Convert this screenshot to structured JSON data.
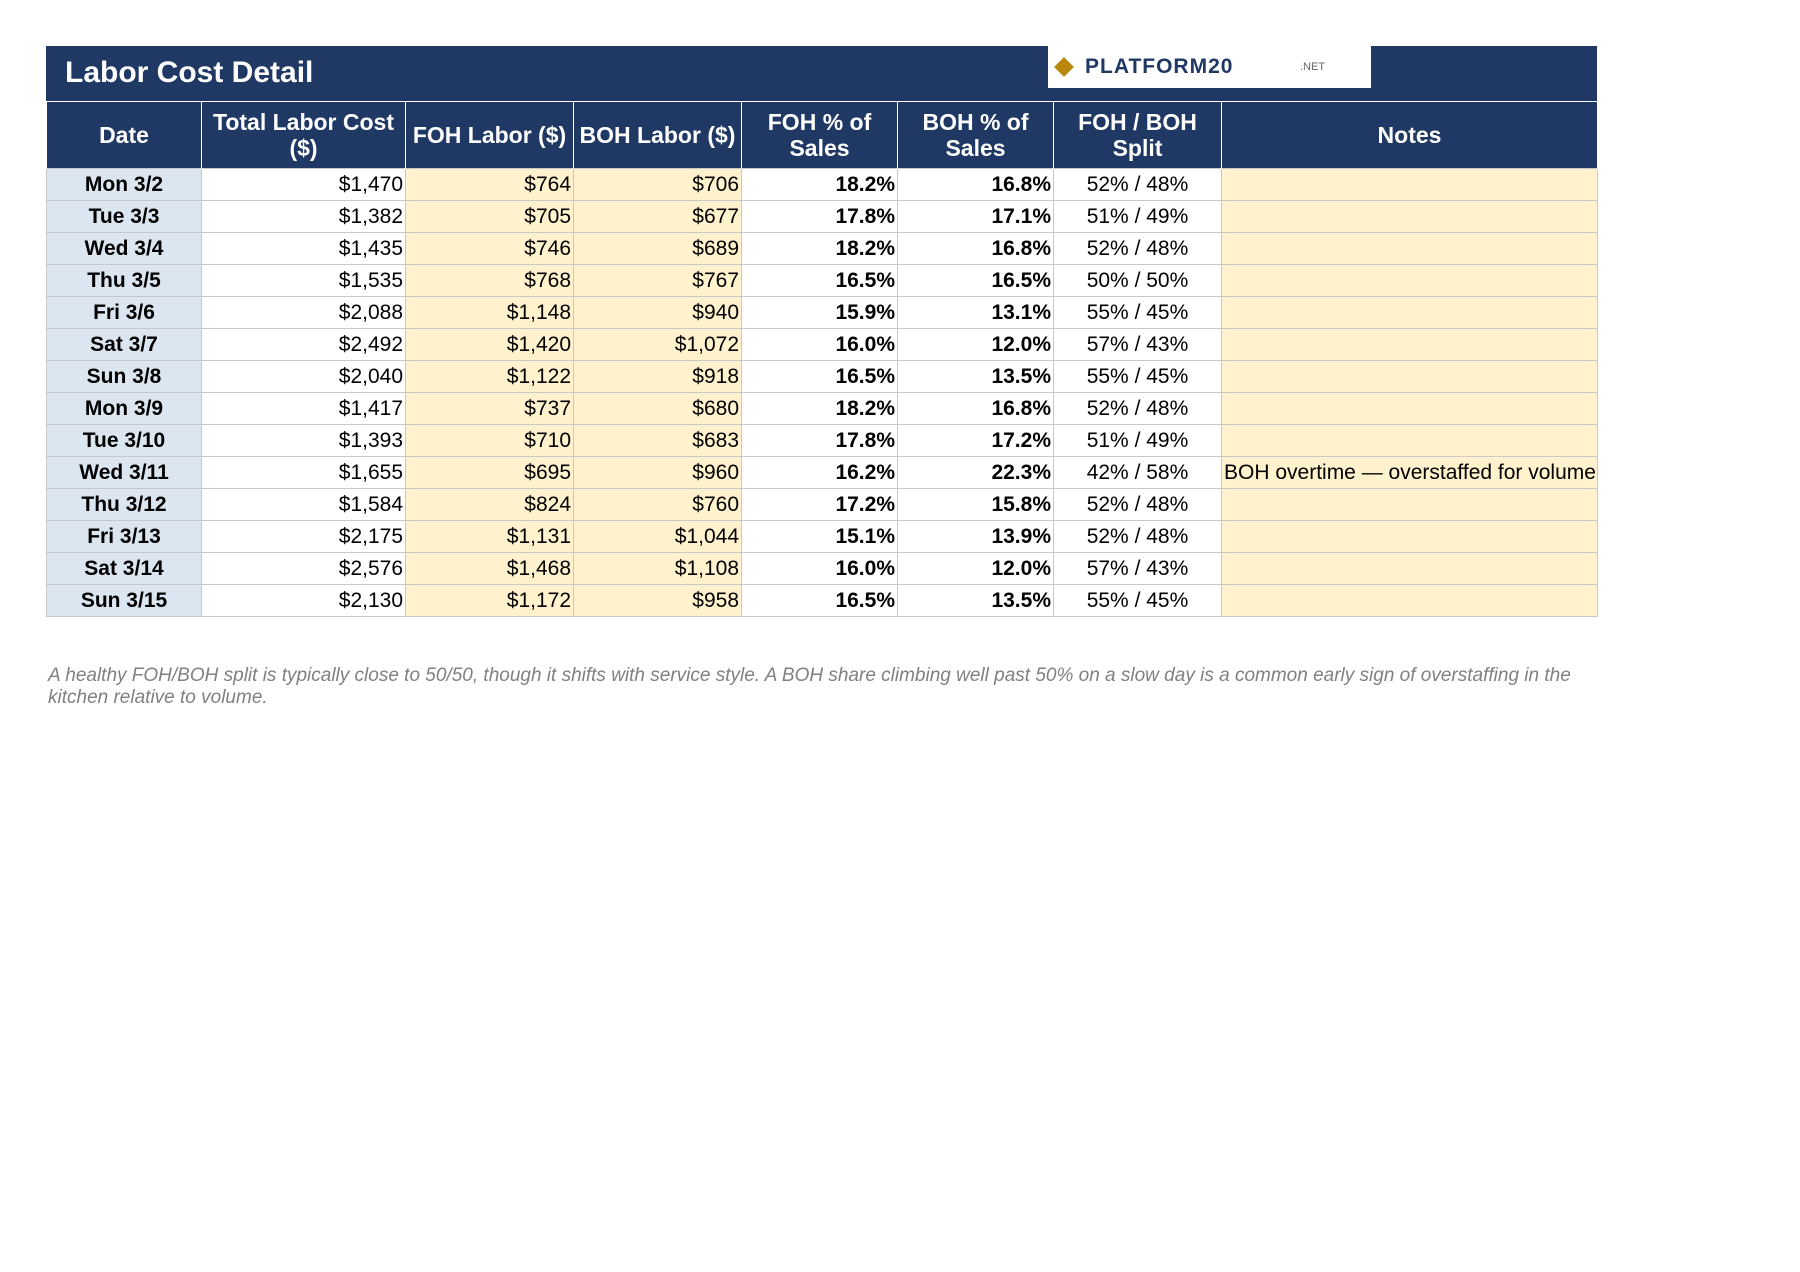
{
  "title": "Labor Cost Detail",
  "logo": {
    "icon": "diamond-icon",
    "word": "PLATFORM20",
    "suffix": ".NET",
    "color": "#b8860b"
  },
  "colors": {
    "header": "#1f3864",
    "date_cell": "#dce6f1",
    "input_cell": "#fff2cc",
    "footnote": "#808080"
  },
  "columns": [
    "Date",
    "Total Labor Cost ($)",
    "FOH Labor ($)",
    "BOH Labor ($)",
    "FOH % of Sales",
    "BOH % of Sales",
    "FOH / BOH Split",
    "Notes"
  ],
  "rows": [
    {
      "date": "Mon 3/2",
      "total": "$1,470",
      "foh": "$764",
      "boh": "$706",
      "foh_pct": "18.2%",
      "boh_pct": "16.8%",
      "split": "52% / 48%",
      "notes": ""
    },
    {
      "date": "Tue 3/3",
      "total": "$1,382",
      "foh": "$705",
      "boh": "$677",
      "foh_pct": "17.8%",
      "boh_pct": "17.1%",
      "split": "51% / 49%",
      "notes": ""
    },
    {
      "date": "Wed 3/4",
      "total": "$1,435",
      "foh": "$746",
      "boh": "$689",
      "foh_pct": "18.2%",
      "boh_pct": "16.8%",
      "split": "52% / 48%",
      "notes": ""
    },
    {
      "date": "Thu 3/5",
      "total": "$1,535",
      "foh": "$768",
      "boh": "$767",
      "foh_pct": "16.5%",
      "boh_pct": "16.5%",
      "split": "50% / 50%",
      "notes": ""
    },
    {
      "date": "Fri 3/6",
      "total": "$2,088",
      "foh": "$1,148",
      "boh": "$940",
      "foh_pct": "15.9%",
      "boh_pct": "13.1%",
      "split": "55% / 45%",
      "notes": ""
    },
    {
      "date": "Sat 3/7",
      "total": "$2,492",
      "foh": "$1,420",
      "boh": "$1,072",
      "foh_pct": "16.0%",
      "boh_pct": "12.0%",
      "split": "57% / 43%",
      "notes": ""
    },
    {
      "date": "Sun 3/8",
      "total": "$2,040",
      "foh": "$1,122",
      "boh": "$918",
      "foh_pct": "16.5%",
      "boh_pct": "13.5%",
      "split": "55% / 45%",
      "notes": ""
    },
    {
      "date": "Mon 3/9",
      "total": "$1,417",
      "foh": "$737",
      "boh": "$680",
      "foh_pct": "18.2%",
      "boh_pct": "16.8%",
      "split": "52% / 48%",
      "notes": ""
    },
    {
      "date": "Tue 3/10",
      "total": "$1,393",
      "foh": "$710",
      "boh": "$683",
      "foh_pct": "17.8%",
      "boh_pct": "17.2%",
      "split": "51% / 49%",
      "notes": ""
    },
    {
      "date": "Wed 3/11",
      "total": "$1,655",
      "foh": "$695",
      "boh": "$960",
      "foh_pct": "16.2%",
      "boh_pct": "22.3%",
      "split": "42% / 58%",
      "notes": "BOH overtime — overstaffed for volume"
    },
    {
      "date": "Thu 3/12",
      "total": "$1,584",
      "foh": "$824",
      "boh": "$760",
      "foh_pct": "17.2%",
      "boh_pct": "15.8%",
      "split": "52% / 48%",
      "notes": ""
    },
    {
      "date": "Fri 3/13",
      "total": "$2,175",
      "foh": "$1,131",
      "boh": "$1,044",
      "foh_pct": "15.1%",
      "boh_pct": "13.9%",
      "split": "52% / 48%",
      "notes": ""
    },
    {
      "date": "Sat 3/14",
      "total": "$2,576",
      "foh": "$1,468",
      "boh": "$1,108",
      "foh_pct": "16.0%",
      "boh_pct": "12.0%",
      "split": "57% / 43%",
      "notes": ""
    },
    {
      "date": "Sun 3/15",
      "total": "$2,130",
      "foh": "$1,172",
      "boh": "$958",
      "foh_pct": "16.5%",
      "boh_pct": "13.5%",
      "split": "55% / 45%",
      "notes": ""
    }
  ],
  "footnote": "A healthy FOH/BOH split is typically close to 50/50, though it shifts with service style. A BOH share climbing well past 50% on a slow day is a common early sign of overstaffing in the kitchen relative to volume."
}
